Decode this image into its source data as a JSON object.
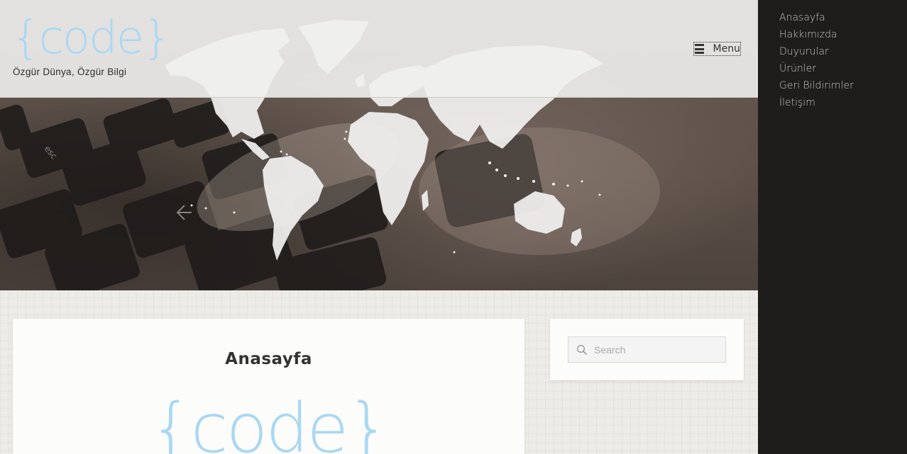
{
  "site": {
    "logo_text": "{code}",
    "tagline": "Özgür Dünya, Özgür Bilgi"
  },
  "header": {
    "menu_label": "Menu"
  },
  "main": {
    "page_title": "Anasayfa",
    "content_logo_text": "{code}"
  },
  "sidebar_widget": {
    "search_placeholder": "Search"
  },
  "nav": {
    "items": [
      {
        "label": "Anasayfa"
      },
      {
        "label": "Hakkımızda"
      },
      {
        "label": "Duyurular"
      },
      {
        "label": "Ürünler"
      },
      {
        "label": "Geri Bildirimler"
      },
      {
        "label": "İletişim"
      }
    ]
  },
  "colors": {
    "logo_blue": "#a9d8f2",
    "nav_background": "#1f1d1b",
    "nav_text": "#c9c6c1"
  }
}
